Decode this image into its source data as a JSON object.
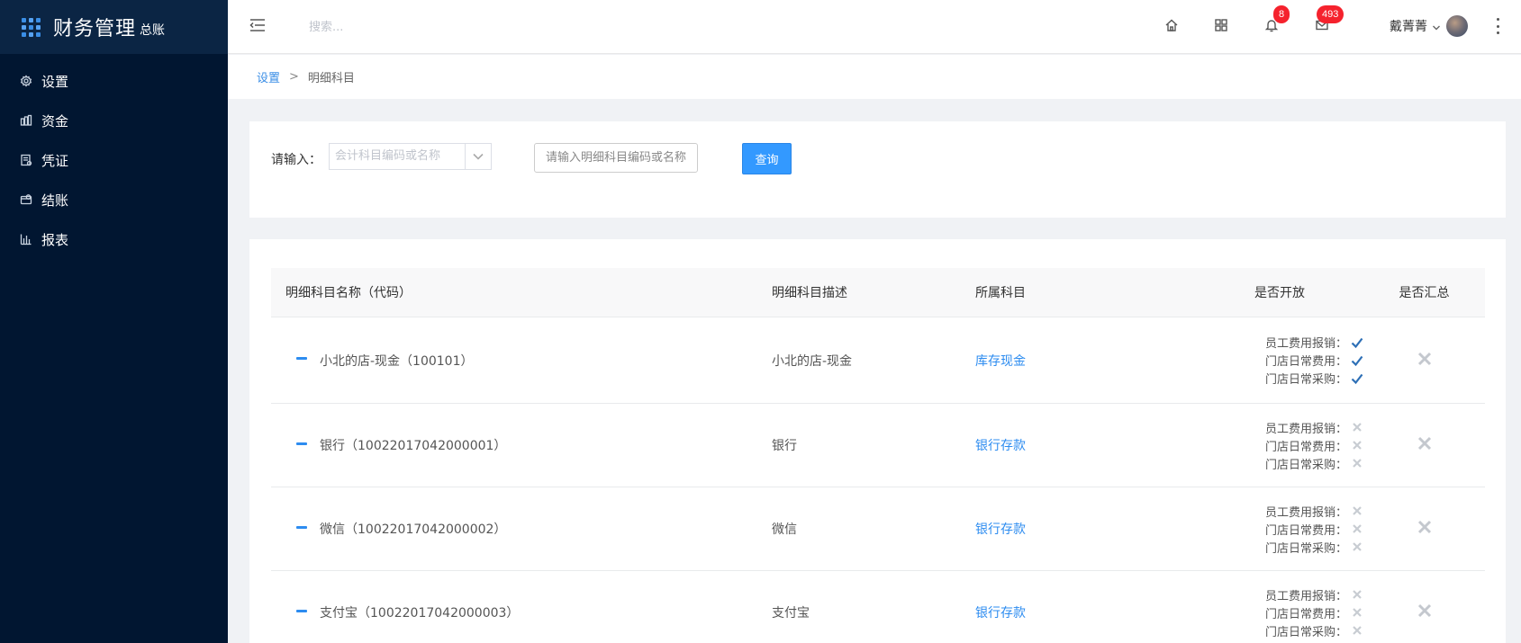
{
  "app": {
    "title": "财务管理",
    "subtitle": "总账"
  },
  "sidebar": {
    "items": [
      {
        "label": "设置",
        "icon": "gear-icon"
      },
      {
        "label": "资金",
        "icon": "funds-icon"
      },
      {
        "label": "凭证",
        "icon": "voucher-icon"
      },
      {
        "label": "结账",
        "icon": "checkout-icon"
      },
      {
        "label": "报表",
        "icon": "report-chart-icon"
      }
    ]
  },
  "topbar": {
    "search_placeholder": "搜索...",
    "notifications_count": "8",
    "messages_count": "493",
    "user_name": "戴菁菁"
  },
  "breadcrumb": {
    "parent": "设置",
    "separator": ">",
    "current": "明细科目"
  },
  "filter": {
    "label": "请输入：",
    "select_placeholder": "会计科目编码或名称",
    "input_placeholder": "请输入明细科目编码或名称",
    "query_button": "查询"
  },
  "table": {
    "headers": {
      "name": "明细科目名称（代码）",
      "desc": "明细科目描述",
      "parent": "所属科目",
      "open": "是否开放",
      "summary": "是否汇总"
    },
    "open_labels": {
      "a": "员工费用报销：",
      "b": "门店日常费用：",
      "c": "门店日常采购："
    },
    "rows": [
      {
        "name": "小北的店-现金（100101）",
        "desc": "小北的店-现金",
        "parent": "库存现金",
        "open": [
          true,
          true,
          true
        ],
        "summary": false
      },
      {
        "name": "银行（10022017042000001）",
        "desc": "银行",
        "parent": "银行存款",
        "open": [
          false,
          false,
          false
        ],
        "summary": false
      },
      {
        "name": "微信（10022017042000002）",
        "desc": "微信",
        "parent": "银行存款",
        "open": [
          false,
          false,
          false
        ],
        "summary": false
      },
      {
        "name": "支付宝（10022017042000003）",
        "desc": "支付宝",
        "parent": "银行存款",
        "open": [
          false,
          false,
          false
        ],
        "summary": false
      }
    ]
  }
}
